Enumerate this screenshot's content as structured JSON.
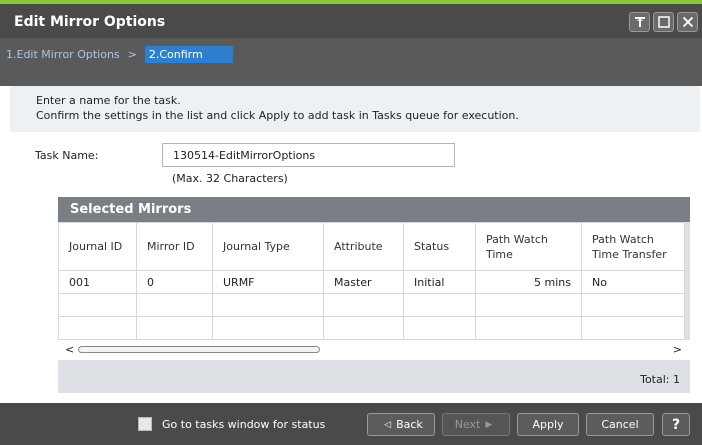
{
  "window": {
    "title": "Edit Mirror Options",
    "controls": [
      "pin-icon",
      "maximize-icon",
      "close-icon"
    ]
  },
  "wizard": {
    "step1": "1.Edit Mirror Options",
    "separator": ">",
    "step2": "2.Confirm"
  },
  "instructions": {
    "line1": "Enter a name for the task.",
    "line2": "Confirm the settings in the list and click Apply to add task in Tasks queue for execution."
  },
  "task": {
    "label": "Task Name:",
    "value": "130514-EditMirrorOptions",
    "hint": "(Max. 32 Characters)"
  },
  "mirrors": {
    "title": "Selected Mirrors",
    "columns": [
      "Journal ID",
      "Mirror ID",
      "Journal Type",
      "Attribute",
      "Status",
      "Path Watch Time",
      "Path Watch Time Transfer"
    ],
    "rows": [
      [
        "001",
        "0",
        "URMF",
        "Master",
        "Initial",
        "5 mins",
        "No"
      ]
    ],
    "scroll_left": "<",
    "scroll_right": ">",
    "total": "Total:  1"
  },
  "footer": {
    "checkbox_label": "Go to tasks window for status",
    "checkbox_checked": false,
    "back": "Back",
    "next": "Next",
    "apply": "Apply",
    "cancel": "Cancel",
    "help": "?"
  },
  "colors": {
    "accent_bar": "#8cc63f",
    "active_step": "#2f7fd0",
    "dark_chrome": "#4a4a4a"
  }
}
